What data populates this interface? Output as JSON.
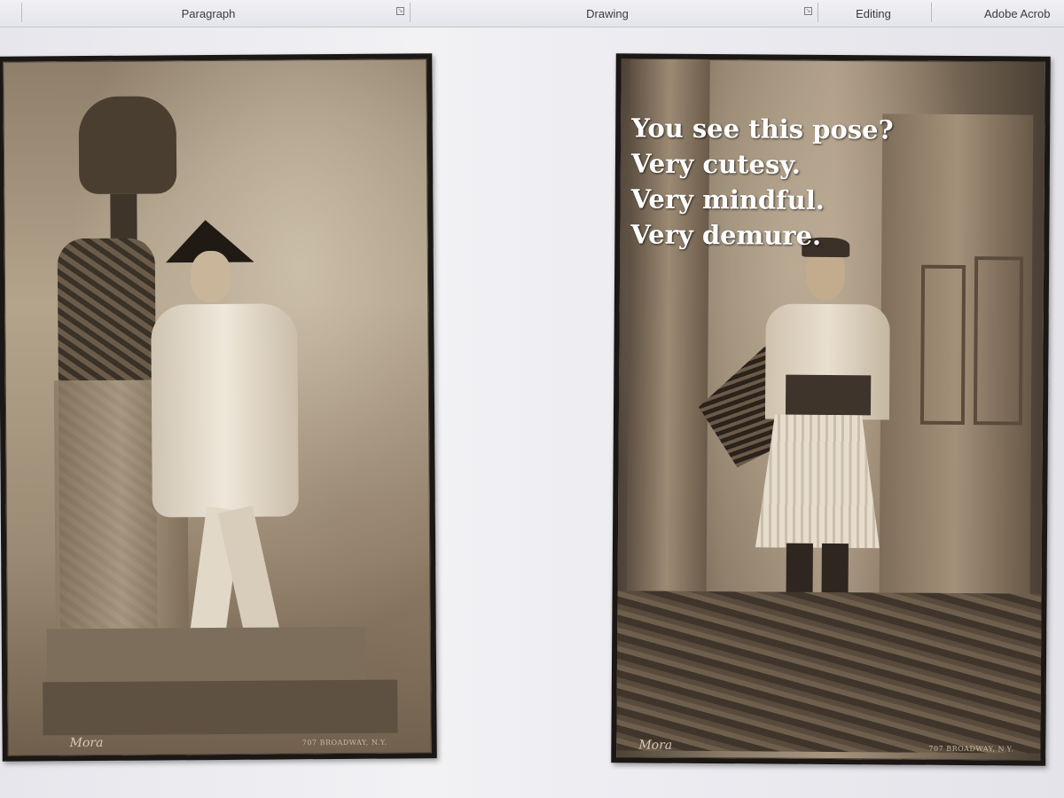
{
  "ribbon": {
    "groups": [
      {
        "label": "Paragraph"
      },
      {
        "label": "Drawing"
      },
      {
        "label": "Editing"
      },
      {
        "label": "Adobe Acrob"
      }
    ]
  },
  "photos": [
    {
      "signature": "Mora",
      "address": "707 BROADWAY, N.Y."
    },
    {
      "signature": "Mora",
      "address": "707 BROADWAY, N.Y.",
      "caption_lines": [
        "You see this pose?",
        "Very cutesy.",
        "Very mindful.",
        "Very demure."
      ]
    }
  ]
}
